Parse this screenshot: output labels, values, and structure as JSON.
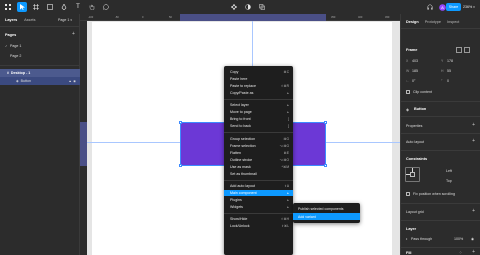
{
  "toolbar": {
    "share_label": "Share",
    "zoom_label": "236%",
    "accent": "#0d99ff"
  },
  "left_panel": {
    "tabs": [
      "Layers",
      "Assets"
    ],
    "page_selector": "Page 1",
    "pages_heading": "Pages",
    "pages": [
      "Page 1",
      "Page 2"
    ],
    "layers": [
      {
        "label": "Desktop - 1"
      },
      {
        "label": "Button"
      }
    ]
  },
  "ruler": {
    "ticks": [
      "-100",
      "-50",
      "0",
      "50",
      "100",
      "150",
      "200",
      "250",
      "300",
      "350",
      "400",
      "450"
    ]
  },
  "context_menu": {
    "items": [
      {
        "label": "Copy",
        "shortcut": "⌘C"
      },
      {
        "label": "Paste here",
        "shortcut": ""
      },
      {
        "label": "Paste to replace",
        "shortcut": "⇧⌘R"
      },
      {
        "label": "Copy/Paste as",
        "shortcut": "▸"
      },
      {
        "label": "Select layer",
        "shortcut": "▸"
      },
      {
        "label": "Move to page",
        "shortcut": "▸"
      },
      {
        "label": "Bring to front",
        "shortcut": "]"
      },
      {
        "label": "Send to back",
        "shortcut": "["
      },
      {
        "label": "Group selection",
        "shortcut": "⌘G"
      },
      {
        "label": "Frame selection",
        "shortcut": "⌥⌘G"
      },
      {
        "label": "Flatten",
        "shortcut": "⌘E"
      },
      {
        "label": "Outline stroke",
        "shortcut": "⌥⌘O"
      },
      {
        "label": "Use as mask",
        "shortcut": "^⌘M"
      },
      {
        "label": "Set as thumbnail",
        "shortcut": ""
      },
      {
        "label": "Add auto layout",
        "shortcut": "⇧A"
      },
      {
        "label": "Main component",
        "shortcut": "▸"
      },
      {
        "label": "Plugins",
        "shortcut": "▸"
      },
      {
        "label": "Widgets",
        "shortcut": "▸"
      },
      {
        "label": "Show/Hide",
        "shortcut": "⇧⌘H"
      },
      {
        "label": "Lock/Unlock",
        "shortcut": "⇧⌘L"
      }
    ],
    "highlighted": "Main component"
  },
  "submenu": {
    "items": [
      "Publish selected components",
      "Add variant"
    ],
    "highlighted": "Add variant"
  },
  "right_panel": {
    "tabs": [
      "Design",
      "Prototype",
      "Inspect"
    ],
    "frame_heading": "Frame",
    "x_label": "X",
    "x_value": "403",
    "y_label": "Y",
    "y_value": "178",
    "w_label": "W",
    "w_value": "185",
    "h_label": "H",
    "h_value": "55",
    "rotation_value": "0°",
    "radius_value": "0",
    "clip_content": "Clip content",
    "component_name": "Button",
    "properties_heading": "Properties",
    "auto_layout_heading": "Auto layout",
    "constraints_heading": "Constraints",
    "constraint_h": "Left",
    "constraint_v": "Top",
    "fix_position": "Fix position when scrolling",
    "layout_grid_heading": "Layout grid",
    "layer_heading": "Layer",
    "blend_mode": "Pass through",
    "opacity_value": "100%",
    "fill_heading": "Fill",
    "purple_color": "#6c38d6"
  }
}
